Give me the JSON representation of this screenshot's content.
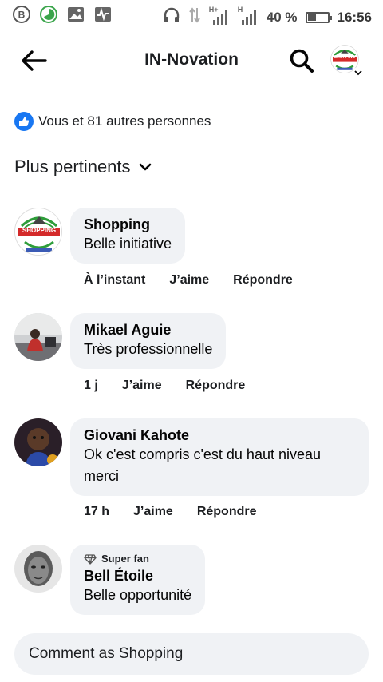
{
  "status_bar": {
    "signal_1": "H+",
    "signal_2": "H",
    "battery": "40 %",
    "battery_level": 0.4,
    "time": "16:56"
  },
  "header": {
    "title": "IN-Novation",
    "page_avatar_text": "SHOPPING"
  },
  "reactions": {
    "text": "Vous et 81 autres personnes"
  },
  "sort": {
    "label": "Plus pertinents"
  },
  "comments": [
    {
      "author": "Shopping",
      "text": "Belle initiative",
      "time": "À l’instant",
      "like": "J’aime",
      "reply": "Répondre",
      "avatar_text": "SHOPPING"
    },
    {
      "author": "Mikael Aguie",
      "text": "Très professionnelle",
      "time": "1 j",
      "like": "J’aime",
      "reply": "Répondre"
    },
    {
      "author": "Giovani Kahote",
      "text_line1": "Ok c'est compris c'est du haut niveau",
      "text_line2": "merci",
      "time": "17 h",
      "like": "J’aime",
      "reply": "Répondre"
    },
    {
      "badge": "Super fan",
      "author": "Bell Étoile",
      "text": "Belle opportunité"
    }
  ],
  "composer": {
    "placeholder": "Comment as Shopping"
  },
  "colors": {
    "accent": "#1877f2",
    "bubble": "#f0f2f5",
    "brand_red": "#d42a2a",
    "brand_green": "#2e9d3a"
  }
}
